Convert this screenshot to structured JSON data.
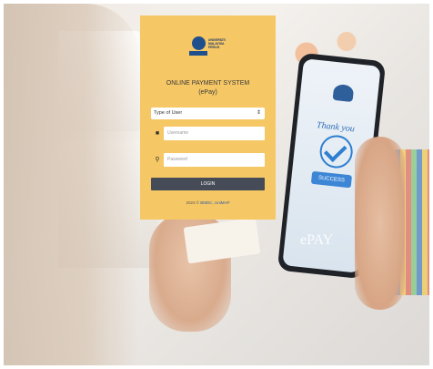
{
  "login": {
    "title_line1": "ONLINE PAYMENT SYSTEM",
    "title_line2": "(ePay)",
    "logo_text": "UNIVERSITI MALAYSIA PERLIS",
    "user_type": {
      "selected": "Type of User"
    },
    "username": {
      "placeholder": "Username"
    },
    "password": {
      "placeholder": "Password"
    },
    "login_label": "LOGIN",
    "footer_prefix": "2023 © ",
    "footer_link": "BMDC, UniMAP"
  },
  "phone": {
    "thank_text": "Thank you",
    "success_text": "SUCCESS",
    "epay_text": "ePAY"
  },
  "icons": {
    "user": "user-icon",
    "key": "key-icon",
    "chevron": "chevron-updown-icon",
    "check": "check-circle-icon"
  },
  "colors": {
    "panel": "#f5c765",
    "button": "#454c57",
    "link": "#2d5ca8"
  }
}
